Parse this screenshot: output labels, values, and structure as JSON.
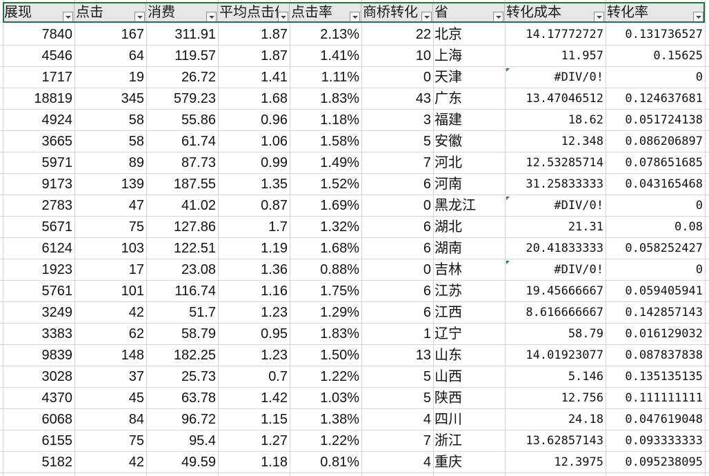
{
  "headers": [
    {
      "key": "col-impressions",
      "label": "展现"
    },
    {
      "key": "col-clicks",
      "label": "点击"
    },
    {
      "key": "col-cost",
      "label": "消费"
    },
    {
      "key": "col-avg-cpc",
      "label": "平均点击价格"
    },
    {
      "key": "col-ctr",
      "label": "点击率"
    },
    {
      "key": "col-conversions",
      "label": "商桥转化"
    },
    {
      "key": "col-province",
      "label": "省"
    },
    {
      "key": "col-cost-per-conv",
      "label": "转化成本"
    },
    {
      "key": "col-conv-rate",
      "label": "转化率"
    }
  ],
  "rows": [
    [
      "7840",
      "167",
      "311.91",
      "1.87",
      "2.13%",
      "22",
      "北京",
      "14.17772727",
      "0.131736527"
    ],
    [
      "4546",
      "64",
      "119.57",
      "1.87",
      "1.41%",
      "10",
      "上海",
      "11.957",
      "0.15625"
    ],
    [
      "1717",
      "19",
      "26.72",
      "1.41",
      "1.11%",
      "0",
      "天津",
      "#DIV/0!",
      "0"
    ],
    [
      "18819",
      "345",
      "579.23",
      "1.68",
      "1.83%",
      "43",
      "广东",
      "13.47046512",
      "0.124637681"
    ],
    [
      "4924",
      "58",
      "55.86",
      "0.96",
      "1.18%",
      "3",
      "福建",
      "18.62",
      "0.051724138"
    ],
    [
      "3665",
      "58",
      "61.74",
      "1.06",
      "1.58%",
      "5",
      "安徽",
      "12.348",
      "0.086206897"
    ],
    [
      "5971",
      "89",
      "87.73",
      "0.99",
      "1.49%",
      "7",
      "河北",
      "12.53285714",
      "0.078651685"
    ],
    [
      "9173",
      "139",
      "187.55",
      "1.35",
      "1.52%",
      "6",
      "河南",
      "31.25833333",
      "0.043165468"
    ],
    [
      "2783",
      "47",
      "41.02",
      "0.87",
      "1.69%",
      "0",
      "黑龙江",
      "#DIV/0!",
      "0"
    ],
    [
      "5671",
      "75",
      "127.86",
      "1.7",
      "1.32%",
      "6",
      "湖北",
      "21.31",
      "0.08"
    ],
    [
      "6124",
      "103",
      "122.51",
      "1.19",
      "1.68%",
      "6",
      "湖南",
      "20.41833333",
      "0.058252427"
    ],
    [
      "1923",
      "17",
      "23.08",
      "1.36",
      "0.88%",
      "0",
      "吉林",
      "#DIV/0!",
      "0"
    ],
    [
      "5761",
      "101",
      "116.74",
      "1.16",
      "1.75%",
      "6",
      "江苏",
      "19.45666667",
      "0.059405941"
    ],
    [
      "3249",
      "42",
      "51.7",
      "1.23",
      "1.29%",
      "6",
      "江西",
      "8.616666667",
      "0.142857143"
    ],
    [
      "3383",
      "62",
      "58.79",
      "0.95",
      "1.83%",
      "1",
      "辽宁",
      "58.79",
      "0.016129032"
    ],
    [
      "9839",
      "148",
      "182.25",
      "1.23",
      "1.50%",
      "13",
      "山东",
      "14.01923077",
      "0.087837838"
    ],
    [
      "3028",
      "37",
      "25.73",
      "0.7",
      "1.22%",
      "5",
      "山西",
      "5.146",
      "0.135135135"
    ],
    [
      "4370",
      "45",
      "63.78",
      "1.42",
      "1.03%",
      "5",
      "陕西",
      "12.756",
      "0.111111111"
    ],
    [
      "6068",
      "84",
      "96.72",
      "1.15",
      "1.38%",
      "4",
      "四川",
      "24.18",
      "0.047619048"
    ],
    [
      "6155",
      "75",
      "95.4",
      "1.27",
      "1.22%",
      "7",
      "浙江",
      "13.62857143",
      "0.093333333"
    ],
    [
      "5182",
      "42",
      "49.59",
      "1.18",
      "0.81%",
      "4",
      "重庆",
      "12.3975",
      "0.095238095"
    ]
  ],
  "error_rows": [
    2,
    8,
    11
  ],
  "colors": {
    "header_bg": "#e6e6e6",
    "grid": "#d4d4d4",
    "selection": "#217346",
    "error_marker": "#1f7a3a"
  },
  "icons": {
    "filter": "filter-dropdown-icon",
    "error": "error-indicator-icon"
  }
}
